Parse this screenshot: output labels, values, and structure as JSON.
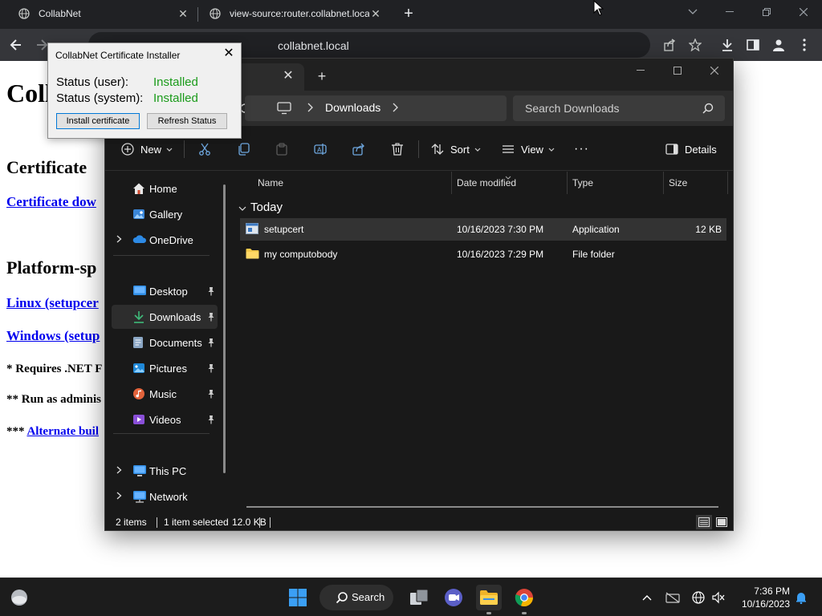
{
  "browser": {
    "tabs": [
      {
        "title": "CollabNet",
        "close": "✕"
      },
      {
        "title": "view-source:router.collabnet.loca",
        "close": "✕"
      }
    ],
    "new_tab": "+",
    "url": "collabnet.local"
  },
  "page": {
    "heading": "Coll",
    "h2_certificate": "Certificate",
    "link_cert_download": "Certificate dow",
    "h2_platform": "Platform-sp",
    "link_linux": "Linux (setupcer",
    "link_windows": "Windows (setup",
    "note1": "* Requires .NET F",
    "note2": "** Run as adminis",
    "note3_prefix": "*** ",
    "note3_link": "Alternate buil"
  },
  "installer": {
    "title": "CollabNet Certificate Installer",
    "close": "✕",
    "status_user_label": "Status (user):",
    "status_user_value": "Installed",
    "status_system_label": "Status (system):",
    "status_system_value": "Installed",
    "install_button": "Install certificate",
    "refresh_button": "Refresh Status"
  },
  "explorer": {
    "tab_close": "✕",
    "new_tab": "+",
    "breadcrumb": "Downloads",
    "search_placeholder": "Search Downloads",
    "commands": {
      "new": "New",
      "sort": "Sort",
      "view": "View",
      "more": "···",
      "details": "Details"
    },
    "nav": [
      {
        "label": "Home",
        "icon": "home-icon",
        "expandable": false,
        "pinned": false
      },
      {
        "label": "Gallery",
        "icon": "gallery-icon",
        "expandable": false,
        "pinned": false
      },
      {
        "label": "OneDrive",
        "icon": "onedrive-icon",
        "expandable": true,
        "pinned": false
      },
      {
        "label": "Desktop",
        "icon": "desktop-icon",
        "expandable": false,
        "pinned": true
      },
      {
        "label": "Downloads",
        "icon": "downloads-icon",
        "expandable": false,
        "pinned": true,
        "selected": true
      },
      {
        "label": "Documents",
        "icon": "documents-icon",
        "expandable": false,
        "pinned": true
      },
      {
        "label": "Pictures",
        "icon": "pictures-icon",
        "expandable": false,
        "pinned": true
      },
      {
        "label": "Music",
        "icon": "music-icon",
        "expandable": false,
        "pinned": true
      },
      {
        "label": "Videos",
        "icon": "videos-icon",
        "expandable": false,
        "pinned": true
      },
      {
        "label": "This PC",
        "icon": "this-pc-icon",
        "expandable": true,
        "pinned": false
      },
      {
        "label": "Network",
        "icon": "network-icon",
        "expandable": true,
        "pinned": false
      }
    ],
    "columns": [
      "Name",
      "Date modified",
      "Type",
      "Size"
    ],
    "group": "Today",
    "files": [
      {
        "name": "setupcert",
        "date": "10/16/2023 7:30 PM",
        "type": "Application",
        "size": "12 KB",
        "selected": true
      },
      {
        "name": "my computobody",
        "date": "10/16/2023 7:29 PM",
        "type": "File folder",
        "size": ""
      }
    ],
    "status": {
      "count": "2 items",
      "selection": "1 item selected",
      "size": "12.0 KB"
    }
  },
  "taskbar": {
    "search_label": "Search",
    "time": "7:36 PM",
    "date": "10/16/2023"
  },
  "colors": {
    "installed_green": "#1a9b1a",
    "folder_yellow": "#f4c94b",
    "accent_blue": "#0078d7"
  }
}
